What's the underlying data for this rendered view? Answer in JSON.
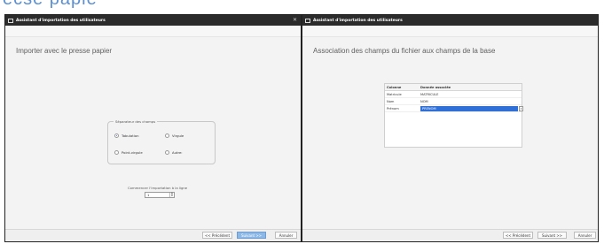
{
  "page_heading": "ecse papie",
  "left_window": {
    "title": "Assistant d'importation des utilisateurs",
    "heading": "Importer avec le presse papier",
    "separator_group": {
      "legend": "Séparateur des champs",
      "options": [
        {
          "label": "Tabulation",
          "checked": true
        },
        {
          "label": "Virgule",
          "checked": false
        },
        {
          "label": "Point-virgule",
          "checked": false
        },
        {
          "label": "Autre:",
          "checked": false
        }
      ]
    },
    "start_label": "Commencer l'importation à la ligne",
    "start_value": "1",
    "buttons": {
      "prev": "<< Précédent",
      "next": "Suivant >>",
      "cancel": "Annuler"
    }
  },
  "right_window": {
    "title": "Assistant d'importation des utilisateurs",
    "heading": "Association des champs du fichier aux champs de la base",
    "table": {
      "headers": [
        "Colonne",
        "Donnée associée"
      ],
      "rows": [
        [
          "Matricule",
          "MATRICULE"
        ],
        [
          "Nom",
          "NOM"
        ],
        [
          "Prénom",
          "PRENOM"
        ]
      ]
    },
    "buttons": {
      "prev": "<< Précédent",
      "next": "Suivant >>",
      "cancel": "Annuler"
    }
  },
  "colors": {
    "accent": "#8cb8e6",
    "selection": "#2f6fd6",
    "titlebar": "#2b2b2b"
  }
}
